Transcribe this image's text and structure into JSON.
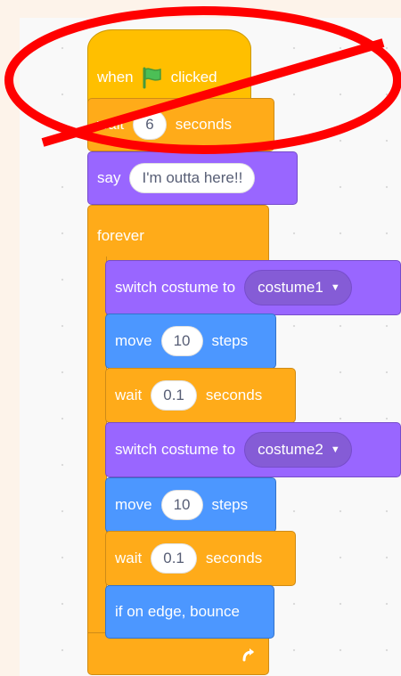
{
  "script": {
    "hat": {
      "when": "when",
      "clicked": "clicked",
      "icon": "green-flag-icon"
    },
    "wait1": {
      "label": "wait",
      "value": "6",
      "unit": "seconds"
    },
    "say": {
      "label": "say",
      "value": "I'm outta here!!"
    },
    "forever": {
      "label": "forever",
      "loop_icon": "loop-arrow-icon"
    },
    "switch1": {
      "label": "switch costume to",
      "value": "costume1"
    },
    "move1": {
      "label": "move",
      "value": "10",
      "unit": "steps"
    },
    "wait2": {
      "label": "wait",
      "value": "0.1",
      "unit": "seconds"
    },
    "switch2": {
      "label": "switch costume to",
      "value": "costume2"
    },
    "move2": {
      "label": "move",
      "value": "10",
      "unit": "steps"
    },
    "wait3": {
      "label": "wait",
      "value": "0.1",
      "unit": "seconds"
    },
    "bounce": {
      "label": "if on edge, bounce"
    }
  },
  "annotation": {
    "type": "prohibition-mark",
    "color": "#ff0000"
  },
  "colors": {
    "events": "#ffbf00",
    "control": "#ffab19",
    "looks": "#9966ff",
    "motion": "#4c97ff",
    "background": "#fdf3ea"
  }
}
